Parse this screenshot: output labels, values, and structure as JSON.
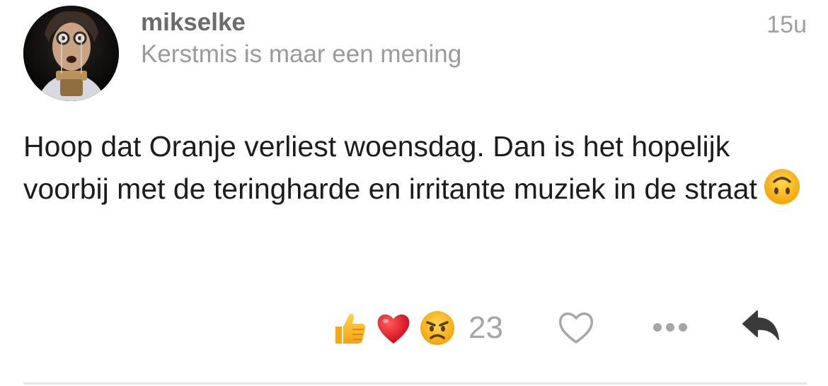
{
  "post": {
    "username": "mikselke",
    "subtitle": "Kerstmis is maar een mening",
    "timestamp": "15u",
    "text": "Hoop dat Oranje verliest woensdag. Dan is het hopelijk voorbij met de teringharde en irritante muziek in de straat",
    "text_emoji": "upside-down-face-icon"
  },
  "reactions": {
    "icons": [
      "thumbs-up-icon",
      "red-heart-icon",
      "angry-face-icon"
    ],
    "count": "23"
  },
  "actions": {
    "like": "heart-outline-icon",
    "more": "more-dots-icon",
    "reply": "reply-arrow-icon"
  },
  "colors": {
    "username": "#6b6b6b",
    "subtitle": "#9a9a9a",
    "text": "#1c1c1c",
    "icon_gray": "#a6a6a6",
    "reply_icon": "#3a3a3a"
  }
}
